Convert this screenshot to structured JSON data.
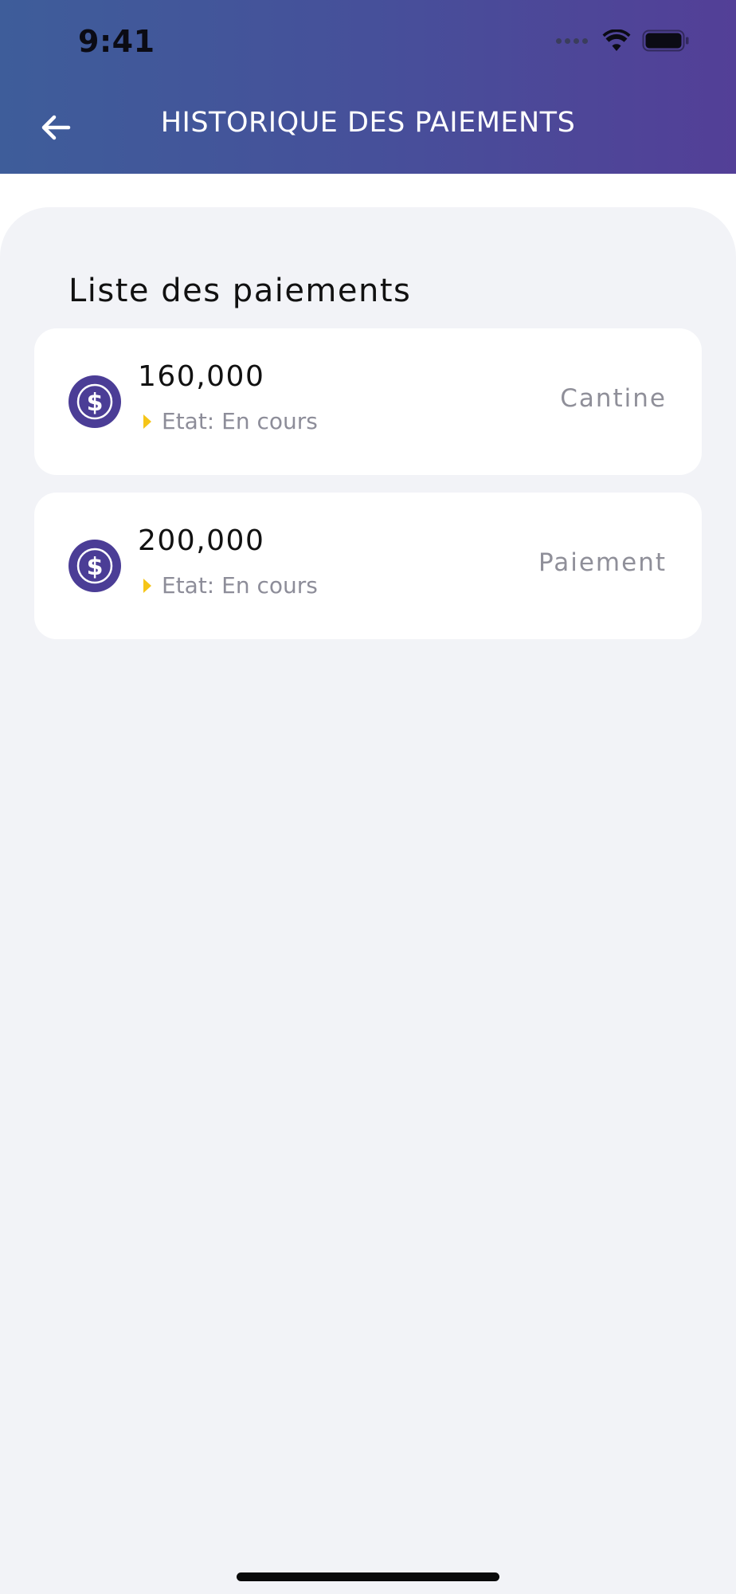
{
  "status_bar": {
    "time": "9:41"
  },
  "header": {
    "title": "HISTORIQUE DES PAIEMENTS",
    "back_icon": "arrow-left-icon",
    "gradient_start": "#3e5d9a",
    "gradient_end": "#533f97"
  },
  "main": {
    "section_title": "Liste des paiements",
    "payments": [
      {
        "amount": "160,000",
        "status": "Etat: En cours",
        "type": "Cantine",
        "icon": "dollar-coin-icon"
      },
      {
        "amount": "200,000",
        "status": "Etat: En cours",
        "type": "Paiement",
        "icon": "dollar-coin-icon"
      }
    ]
  },
  "colors": {
    "accent": "#4b3d96",
    "status_marker": "#f5c518",
    "content_background": "#f2f3f7"
  }
}
